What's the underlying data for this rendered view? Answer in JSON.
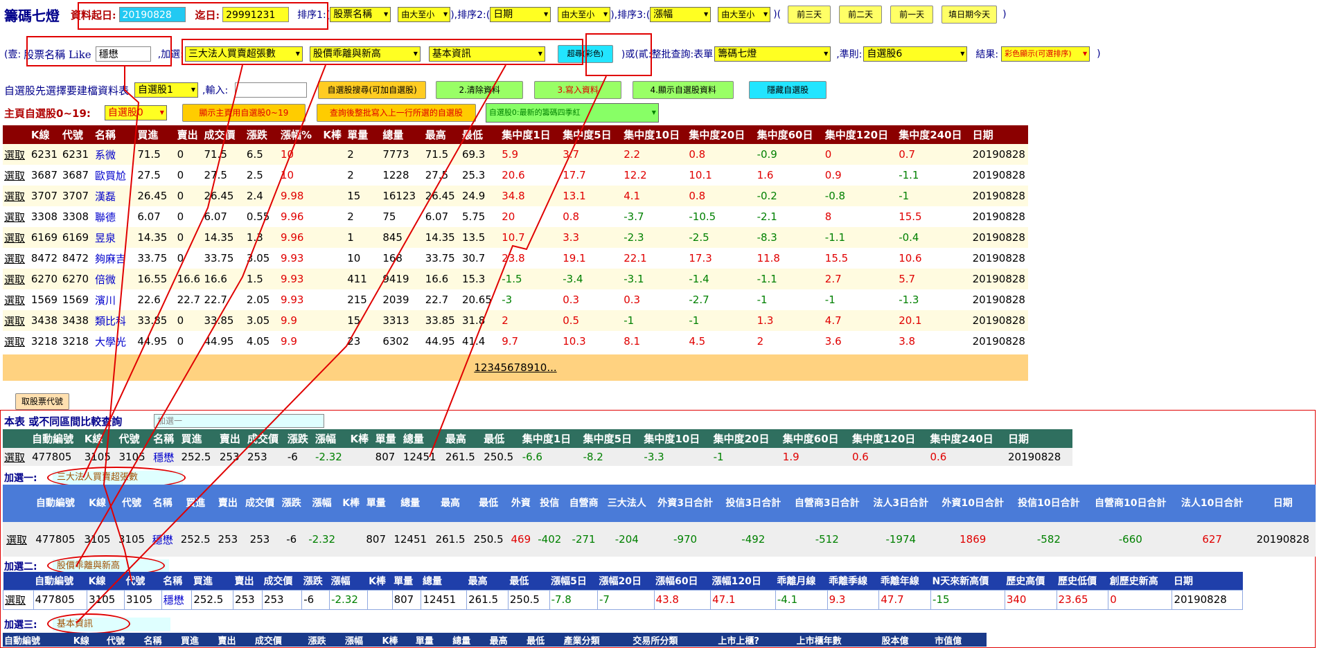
{
  "header": {
    "title": "籌碼七燈",
    "start_label": "資料起日:",
    "start_value": "20190828",
    "end_label": "迄日:",
    "end_value": "29991231",
    "sort1_label": "排序1:(",
    "sort1_field": "股票名稱",
    "sort1_order": "由大至小",
    "sort2_label": "),排序2:(",
    "sort2_field": "日期",
    "sort2_order": "由大至小",
    "sort3_label": "),排序3:(",
    "sort3_field": "漲幅",
    "sort3_order": "由大至小",
    "sort_end": ")(",
    "btn_3days": "前三天",
    "btn_2days": "前二天",
    "btn_1day": "前一天",
    "btn_today": "填日期今天",
    "end_paren": ")"
  },
  "query": {
    "prefix": "(壹:",
    "name_like_label": "股票名稱 Like",
    "name_like_value": "穩懋",
    "add_label": ",加選:",
    "add1": "三大法人買賣超張數",
    "add2": "股價乖離與新高",
    "add3": "基本資訊",
    "search_btn": "超尋(彩色)",
    "or_label": ")或(貳:整批查詢:表單",
    "form_value": "籌碼七燈",
    "rule_label": ",準則:",
    "rule_value": "自選股6",
    "result_label": "結果:",
    "result_value": "彩色顯示(可選排序)",
    "end": ")"
  },
  "self_select": {
    "label": "自選股先選擇要建檔資料表",
    "table_value": "自選股1",
    "input_label": ",輸入:",
    "input_value": "",
    "btn1": "自選股搜尋(可加自選股)",
    "btn2": "2.清除資料",
    "btn3": "3.寫入資料",
    "btn4": "4.顯示自選股資料",
    "btn5": "隱藏自選股"
  },
  "main_page": {
    "label": "主頁自選股0~19:",
    "value": "自選股0",
    "btn1": "顯示主頁用自選股0~19",
    "btn2": "查詢後整批寫入上一行所選的自選股",
    "list_value": "自選股0:最新的籌碼四季紅"
  },
  "table1": {
    "headers": [
      "",
      "K線",
      "代號",
      "名稱",
      "買進",
      "賣出",
      "成交價",
      "漲跌",
      "漲幅%",
      "K棒",
      "單量",
      "總量",
      "最高",
      "最低",
      "集中度1日",
      "集中度5日",
      "集中度10日",
      "集中度20日",
      "集中度60日",
      "集中度120日",
      "集中度240日",
      "日期"
    ],
    "rows": [
      [
        "選取",
        "6231",
        "6231",
        "系微",
        "71.5",
        "0",
        "71.5",
        "6.5",
        "10",
        "",
        "2",
        "7773",
        "71.5",
        "69.3",
        "5.9",
        "3.7",
        "2.2",
        "0.8",
        "-0.9",
        "0",
        "0.7",
        "20190828"
      ],
      [
        "選取",
        "3687",
        "3687",
        "歐買尬",
        "27.5",
        "0",
        "27.5",
        "2.5",
        "10",
        "",
        "2",
        "1228",
        "27.5",
        "25.3",
        "20.6",
        "17.7",
        "12.2",
        "10.1",
        "1.6",
        "0.9",
        "-1.1",
        "20190828"
      ],
      [
        "選取",
        "3707",
        "3707",
        "漢磊",
        "26.45",
        "0",
        "26.45",
        "2.4",
        "9.98",
        "",
        "15",
        "16123",
        "26.45",
        "24.9",
        "34.8",
        "13.1",
        "4.1",
        "0.8",
        "-0.2",
        "-0.8",
        "-1",
        "20190828"
      ],
      [
        "選取",
        "3308",
        "3308",
        "聯德",
        "6.07",
        "0",
        "6.07",
        "0.55",
        "9.96",
        "",
        "2",
        "75",
        "6.07",
        "5.75",
        "20",
        "0.8",
        "-3.7",
        "-10.5",
        "-2.1",
        "8",
        "15.5",
        "20190828"
      ],
      [
        "選取",
        "6169",
        "6169",
        "昱泉",
        "14.35",
        "0",
        "14.35",
        "1.3",
        "9.96",
        "",
        "1",
        "845",
        "14.35",
        "13.5",
        "10.7",
        "3.3",
        "-2.3",
        "-2.5",
        "-8.3",
        "-1.1",
        "-0.4",
        "20190828"
      ],
      [
        "選取",
        "8472",
        "8472",
        "夠麻吉",
        "33.75",
        "0",
        "33.75",
        "3.05",
        "9.93",
        "",
        "10",
        "168",
        "33.75",
        "30.7",
        "23.8",
        "19.1",
        "22.1",
        "17.3",
        "11.8",
        "15.5",
        "10.6",
        "20190828"
      ],
      [
        "選取",
        "6270",
        "6270",
        "倍微",
        "16.55",
        "16.6",
        "16.6",
        "1.5",
        "9.93",
        "",
        "411",
        "9419",
        "16.6",
        "15.3",
        "-1.5",
        "-3.4",
        "-3.1",
        "-1.4",
        "-1.1",
        "2.7",
        "5.7",
        "20190828"
      ],
      [
        "選取",
        "1569",
        "1569",
        "濱川",
        "22.6",
        "22.7",
        "22.7",
        "2.05",
        "9.93",
        "",
        "215",
        "2039",
        "22.7",
        "20.65",
        "-3",
        "0.3",
        "0.3",
        "-2.7",
        "-1",
        "-1",
        "-1.3",
        "20190828"
      ],
      [
        "選取",
        "3438",
        "3438",
        "類比科",
        "33.85",
        "0",
        "33.85",
        "3.05",
        "9.9",
        "",
        "15",
        "3313",
        "33.85",
        "31.8",
        "2",
        "0.5",
        "-1",
        "-1",
        "1.3",
        "4.7",
        "20.1",
        "20190828"
      ],
      [
        "選取",
        "3218",
        "3218",
        "大學光",
        "44.95",
        "0",
        "44.95",
        "4.05",
        "9.9",
        "",
        "23",
        "6302",
        "44.95",
        "41.4",
        "9.7",
        "10.3",
        "8.1",
        "4.5",
        "2",
        "3.6",
        "3.8",
        "20190828"
      ]
    ],
    "pager": "12345678910..."
  },
  "get_code_btn": "取股票代號",
  "section_main": {
    "label": "本表 或不同區間比較查詢",
    "input_placeholder": "加選一",
    "headers": [
      "",
      "自動編號",
      "K線",
      "代號",
      "名稱",
      "買進",
      "賣出",
      "成交價",
      "漲跌",
      "漲幅",
      "K棒",
      "單量",
      "總量",
      "最高",
      "最低",
      "集中度1日",
      "集中度5日",
      "集中度10日",
      "集中度20日",
      "集中度60日",
      "集中度120日",
      "集中度240日",
      "日期"
    ],
    "row": [
      "選取",
      "477805",
      "3105",
      "3105",
      "穩懋",
      "252.5",
      "253",
      "253",
      "-6",
      "-2.32",
      "",
      "807",
      "12451",
      "261.5",
      "250.5",
      "-6.6",
      "-8.2",
      "-3.3",
      "-1",
      "1.9",
      "0.6",
      "0.6",
      "20190828"
    ]
  },
  "section_add1": {
    "label": "加選一:",
    "tag": "三大法人買賣超張數",
    "headers": [
      "",
      "自動編號",
      "K線",
      "代號",
      "名稱",
      "買進",
      "賣出",
      "成交價",
      "漲跌",
      "漲幅",
      "K棒",
      "單量",
      "總量",
      "最高",
      "最低",
      "外資",
      "投信",
      "自營商",
      "三大法人",
      "外資3日合計",
      "投信3日合計",
      "自營商3日合計",
      "法人3日合計",
      "外資10日合計",
      "投信10日合計",
      "自營商10日合計",
      "法人10日合計",
      "日期"
    ],
    "row": [
      "選取",
      "477805",
      "3105",
      "3105",
      "穩懋",
      "252.5",
      "253",
      "253",
      "-6",
      "-2.32",
      "",
      "807",
      "12451",
      "261.5",
      "250.5",
      "469",
      "-402",
      "-271",
      "-204",
      "-970",
      "-492",
      "-512",
      "-1974",
      "1869",
      "-582",
      "-660",
      "627",
      "20190828"
    ]
  },
  "section_add2": {
    "label": "加選二:",
    "tag": "股價乖離與新高",
    "headers": [
      "",
      "自動編號",
      "K線",
      "代號",
      "名稱",
      "買進",
      "賣出",
      "成交價",
      "漲跌",
      "漲幅",
      "K棒",
      "單量",
      "總量",
      "最高",
      "最低",
      "漲幅5日",
      "漲幅20日",
      "漲幅60日",
      "漲幅120日",
      "乖離月線",
      "乖離季線",
      "乖離年線",
      "N天來新高價",
      "歷史高價",
      "歷史低價",
      "創歷史新高",
      "日期"
    ],
    "row": [
      "選取",
      "477805",
      "3105",
      "3105",
      "穩懋",
      "252.5",
      "253",
      "253",
      "-6",
      "-2.32",
      "",
      "807",
      "12451",
      "261.5",
      "250.5",
      "-7.8",
      "-7",
      "43.8",
      "47.1",
      "-4.1",
      "9.3",
      "47.7",
      "-15",
      "340",
      "23.65",
      "0",
      "20190828"
    ]
  },
  "section_add3": {
    "label": "加選三:",
    "tag": "基本資訊",
    "headers": [
      "自動編號",
      "K線",
      "代號",
      "名稱",
      "買進",
      "賣出",
      "成交價",
      "漲跌",
      "漲幅",
      "K棒",
      "單量",
      "總量",
      "最高",
      "最低",
      "產業分類",
      "交易所分類",
      "上市上櫃?",
      "上市櫃年數",
      "股本億",
      "市值億"
    ]
  },
  "colors": {
    "accent_red": "#e00000",
    "header_dark_red": "#8b0000",
    "header_green": "#2f6f5f",
    "header_blue": "#4a7bd8",
    "pager_bg": "#ffd280"
  }
}
